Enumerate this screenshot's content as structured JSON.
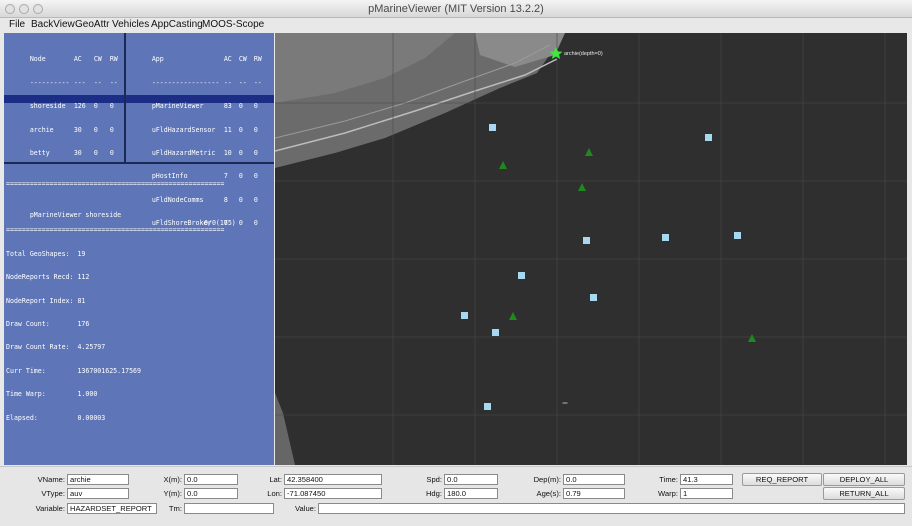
{
  "window": {
    "title": "pMarineViewer (MIT Version 13.2.2)"
  },
  "menu": [
    "File",
    "BackView",
    "GeoAttr",
    "Vehicles",
    "AppCasting",
    "MOOS-Scope"
  ],
  "nodes": {
    "header": [
      "Node",
      "AC",
      "CW",
      "RW"
    ],
    "divider": [
      "----------",
      "---",
      "--",
      "--"
    ],
    "rows": [
      [
        "shoreside",
        "126",
        "0",
        "0"
      ],
      [
        "archie",
        "30",
        "0",
        "0"
      ],
      [
        "betty",
        "30",
        "0",
        "0"
      ]
    ]
  },
  "apps": {
    "header": [
      "App",
      "AC",
      "CW",
      "RW"
    ],
    "divider": [
      "-----------------",
      "--",
      "--",
      "--"
    ],
    "rows": [
      [
        "pMarineViewer",
        "83",
        "0",
        "0"
      ],
      [
        "uFldHazardSensor",
        "11",
        "0",
        "0"
      ],
      [
        "uFldHazardMetric",
        "10",
        "0",
        "0"
      ],
      [
        "pHostInfo",
        "7",
        "0",
        "0"
      ],
      [
        "uFldNodeComms",
        "8",
        "0",
        "0"
      ],
      [
        "uFldShoreBroker",
        "7",
        "0",
        "0"
      ]
    ]
  },
  "appcast": {
    "rule": "=======================================================",
    "heading": "pMarineViewer shoreside",
    "heading_right": "0/0(165)",
    "lines": [
      "Total GeoShapes:  19",
      "NodeReports Recd: 112",
      "NodeReport Index: 81",
      "Draw Count:       176",
      "Draw Count Rate:  4.25797",
      "Curr Time:        1367001625.17569",
      "Time Warp:        1.000",
      "Elapsed:          0.00003"
    ]
  },
  "map": {
    "vehicle_label": "archie(depth=0)",
    "vehicle_color": "#3ee83e",
    "hazard_color": "#a8d8f0",
    "benign_color": "#1e8a1e"
  },
  "controls": {
    "vname": {
      "label": "VName:",
      "value": "archie"
    },
    "vtype": {
      "label": "VType:",
      "value": "auv"
    },
    "xm": {
      "label": "X(m):",
      "value": "0.0"
    },
    "ym": {
      "label": "Y(m):",
      "value": "0.0"
    },
    "lat": {
      "label": "Lat:",
      "value": "42.358400"
    },
    "lon": {
      "label": "Lon:",
      "value": "-71.087450"
    },
    "spd": {
      "label": "Spd:",
      "value": "0.0"
    },
    "hdg": {
      "label": "Hdg:",
      "value": "180.0"
    },
    "dep": {
      "label": "Dep(m):",
      "value": "0.0"
    },
    "age": {
      "label": "Age(s):",
      "value": "0.79"
    },
    "time": {
      "label": "Time:",
      "value": "41.3"
    },
    "warp": {
      "label": "Warp:",
      "value": "1"
    },
    "variable": {
      "label": "Variable:",
      "value": "HAZARDSET_REPORT"
    },
    "tm": {
      "label": "Tm:",
      "value": ""
    },
    "value": {
      "label": "Value:",
      "value": ""
    },
    "buttons": {
      "req_report": "REQ_REPORT",
      "deploy_all": "DEPLOY_ALL",
      "return_all": "RETURN_ALL"
    }
  }
}
